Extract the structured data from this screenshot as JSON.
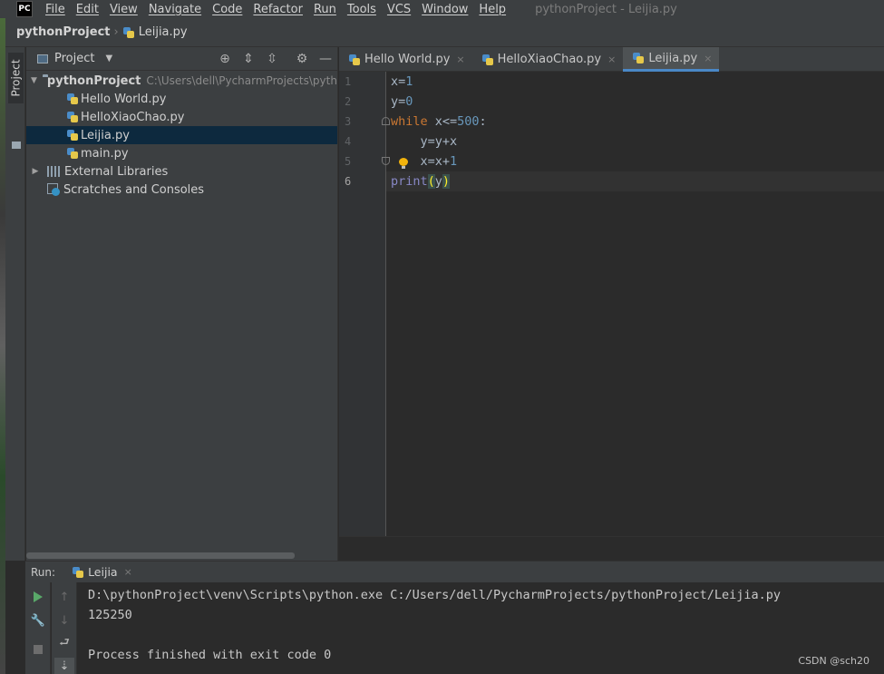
{
  "app": {
    "logo": "PC",
    "window_title": "pythonProject - Leijia.py"
  },
  "menu": [
    "File",
    "Edit",
    "View",
    "Navigate",
    "Code",
    "Refactor",
    "Run",
    "Tools",
    "VCS",
    "Window",
    "Help"
  ],
  "navbar": {
    "project": "pythonProject",
    "separator": "›",
    "file": "Leijia.py"
  },
  "tool_stripe": {
    "project_label": "Project"
  },
  "project_panel": {
    "title": "Project",
    "tree": [
      {
        "label": "pythonProject",
        "path": "C:\\Users\\dell\\PycharmProjects\\pytho",
        "type": "folder",
        "expanded": true
      },
      {
        "label": "Hello World.py",
        "type": "py"
      },
      {
        "label": "HelloXiaoChao.py",
        "type": "py"
      },
      {
        "label": "Leijia.py",
        "type": "py",
        "selected": true
      },
      {
        "label": "main.py",
        "type": "py"
      },
      {
        "label": "External Libraries",
        "type": "lib"
      },
      {
        "label": "Scratches and Consoles",
        "type": "scratch"
      }
    ]
  },
  "editor": {
    "tabs": [
      {
        "label": "Hello World.py",
        "close": "×"
      },
      {
        "label": "HelloXiaoChao.py",
        "close": "×"
      },
      {
        "label": "Leijia.py",
        "close": "×",
        "active": true
      }
    ],
    "line_numbers": [
      "1",
      "2",
      "3",
      "4",
      "5",
      "6"
    ],
    "code": {
      "l1_var": "x",
      "l1_op": "=",
      "l1_num": "1",
      "l2_var": "y",
      "l2_op": "=",
      "l2_num": "0",
      "l3_kw": "while",
      "l3_rest": " x<=",
      "l3_num": "500",
      "l3_end": ":",
      "l4_text": "    y=y+x",
      "l5_text": "    x=x+",
      "l5_num": "1",
      "l6_fn": "print",
      "l6_open": "(",
      "l6_arg": "y",
      "l6_close": ")"
    }
  },
  "run": {
    "label": "Run:",
    "tab_label": "Leijia",
    "tab_close": "×",
    "console": [
      "D:\\pythonProject\\venv\\Scripts\\python.exe C:/Users/dell/PycharmProjects/pythonProject/Leijia.py",
      "125250",
      "",
      "Process finished with exit code 0"
    ]
  },
  "watermark": "CSDN @sch20",
  "colors": {
    "background": "#2b2b2b",
    "panel": "#3c3f41",
    "keyword": "#cc7832",
    "number": "#6897bb",
    "builtin": "#8888c6",
    "selection": "#0d293e",
    "run_green": "#59a869"
  }
}
